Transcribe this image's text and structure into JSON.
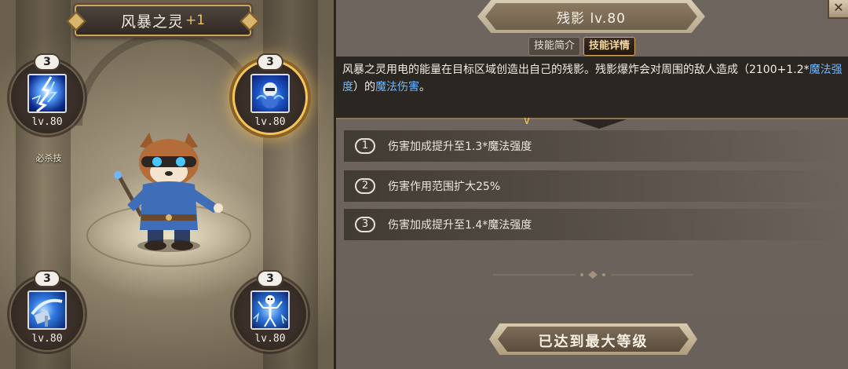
{
  "hero": {
    "name": "风暴之灵",
    "plus": "+1"
  },
  "skills": [
    {
      "count": "3",
      "level": "lv.80",
      "tag": "必杀技",
      "icon": "lightning-icon"
    },
    {
      "count": "3",
      "level": "lv.80",
      "icon": "spirit-clone-icon",
      "selected": true
    },
    {
      "count": "3",
      "level": "lv.80",
      "icon": "hammer-icon"
    },
    {
      "count": "3",
      "level": "lv.80",
      "icon": "skeleton-shock-icon"
    }
  ],
  "detail": {
    "title": "残影 lv.80",
    "tabs": [
      "技能简介",
      "技能详情"
    ],
    "active_tab": "技能详情",
    "close": "✕",
    "description": {
      "part1": "风暴之灵用电的能量在目标区域创造出自己的残影。残影爆炸会对周围的敌人造成（2100+1.2*",
      "hl1": "魔法强度",
      "part2": "）的",
      "hl2": "魔法伤害",
      "part3": "。"
    },
    "upgrades": [
      {
        "num": "1",
        "text": "伤害加成提升至1.3*",
        "hl": "魔法强度"
      },
      {
        "num": "2",
        "text": "伤害作用范围扩大25%",
        "hl": ""
      },
      {
        "num": "3",
        "text": "伤害加成提升至1.4*",
        "hl": "魔法强度"
      }
    ],
    "max_label": "已达到最大等级"
  },
  "colors": {
    "highlight": "#6fb7ff",
    "gold": "#f0c453",
    "panel_dark": "#2a2622"
  }
}
